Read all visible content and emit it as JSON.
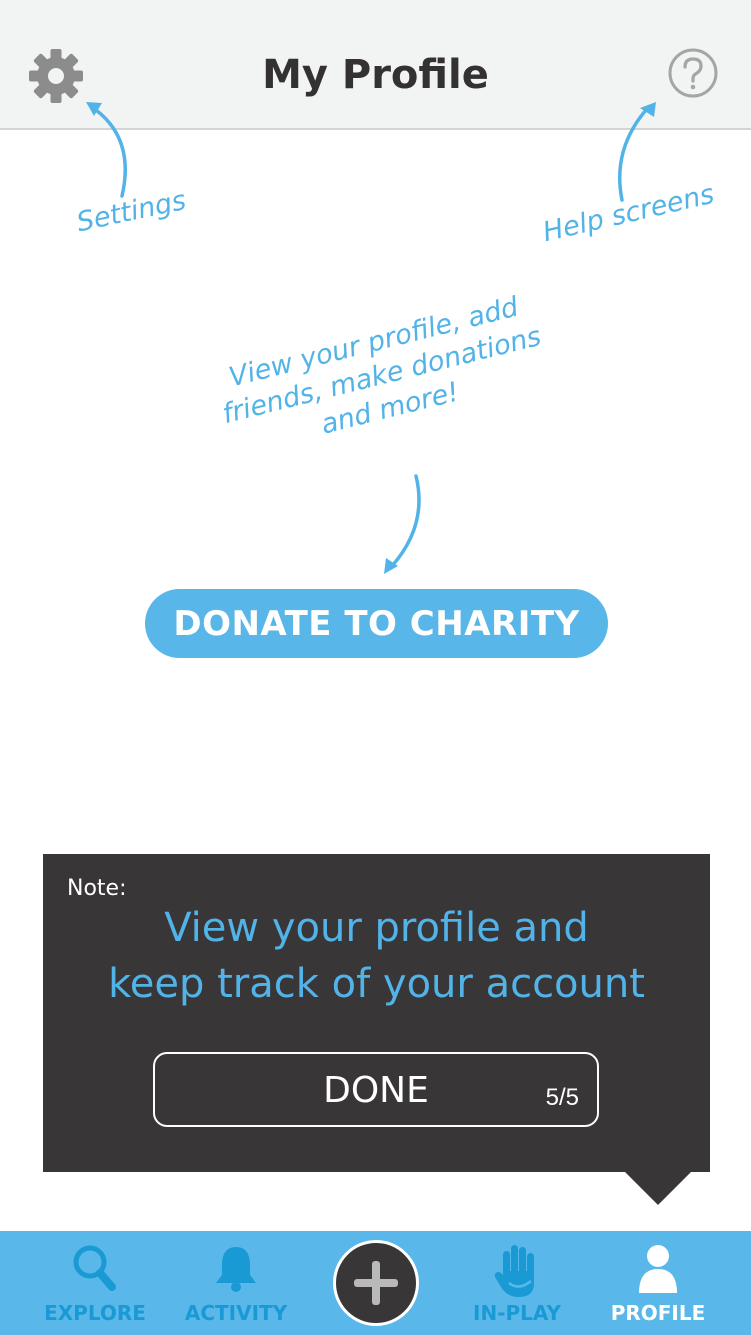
{
  "header": {
    "title": "My Profile",
    "settings_icon": "gear-icon",
    "help_icon": "question-circle-icon"
  },
  "annotations": {
    "settings": "Settings",
    "help": "Help screens",
    "profile_lines": [
      "View your profile, add",
      "friends, make donations",
      "and more!"
    ]
  },
  "main": {
    "donate_label": "DONATE TO CHARITY"
  },
  "note": {
    "label": "Note:",
    "message_lines": [
      "View your profile and",
      "keep track of your account"
    ],
    "done_label": "DONE",
    "counter": "5/5"
  },
  "tabbar": {
    "items": [
      {
        "label": "EXPLORE",
        "icon": "search-icon",
        "active": false
      },
      {
        "label": "ACTIVITY",
        "icon": "bell-icon",
        "active": false
      },
      {
        "label": "",
        "icon": "plus-icon",
        "active": false
      },
      {
        "label": "IN-PLAY",
        "icon": "hand-icon",
        "active": false
      },
      {
        "label": "PROFILE",
        "icon": "person-icon",
        "active": true
      }
    ]
  },
  "colors": {
    "accent": "#58b6e8",
    "dark": "#393637",
    "header_bg": "#f2f3f3",
    "inactive_tab_text": "#1a9ad4"
  }
}
